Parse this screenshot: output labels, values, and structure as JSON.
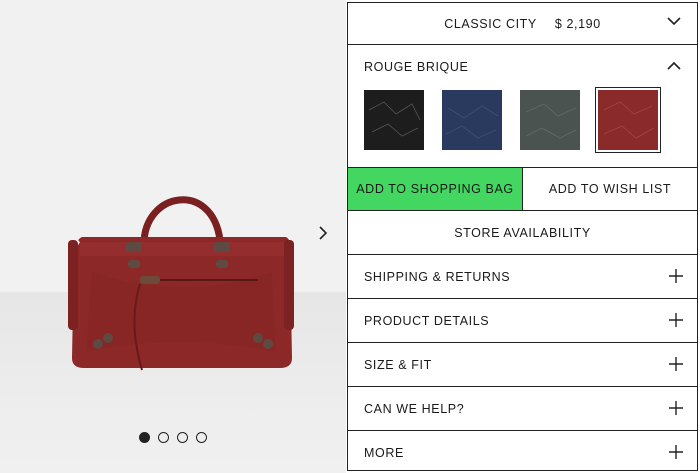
{
  "gallery": {
    "slides": 4,
    "active_slide": 1,
    "colors": {
      "background": "#f1f1f1",
      "bag": "#8f2a2a"
    }
  },
  "product": {
    "name": "CLASSIC CITY",
    "price": "$ 2,190"
  },
  "color_selector": {
    "selected_label": "ROUGE BRIQUE",
    "swatches": [
      {
        "name": "black",
        "color": "#1d1d1d"
      },
      {
        "name": "navy",
        "color": "#2a3a5e"
      },
      {
        "name": "slate green",
        "color": "#4a5350"
      },
      {
        "name": "rouge brique",
        "color": "#8a2a2a",
        "selected": true
      }
    ]
  },
  "actions": {
    "add_to_bag": "ADD TO SHOPPING BAG",
    "add_to_wishlist": "ADD TO WISH LIST",
    "store_availability": "STORE AVAILABILITY",
    "accent_color": "#43d661"
  },
  "accordion": [
    {
      "label": "SHIPPING & RETURNS"
    },
    {
      "label": "PRODUCT DETAILS"
    },
    {
      "label": "SIZE & FIT"
    },
    {
      "label": "CAN WE HELP?"
    },
    {
      "label": "MORE"
    }
  ]
}
